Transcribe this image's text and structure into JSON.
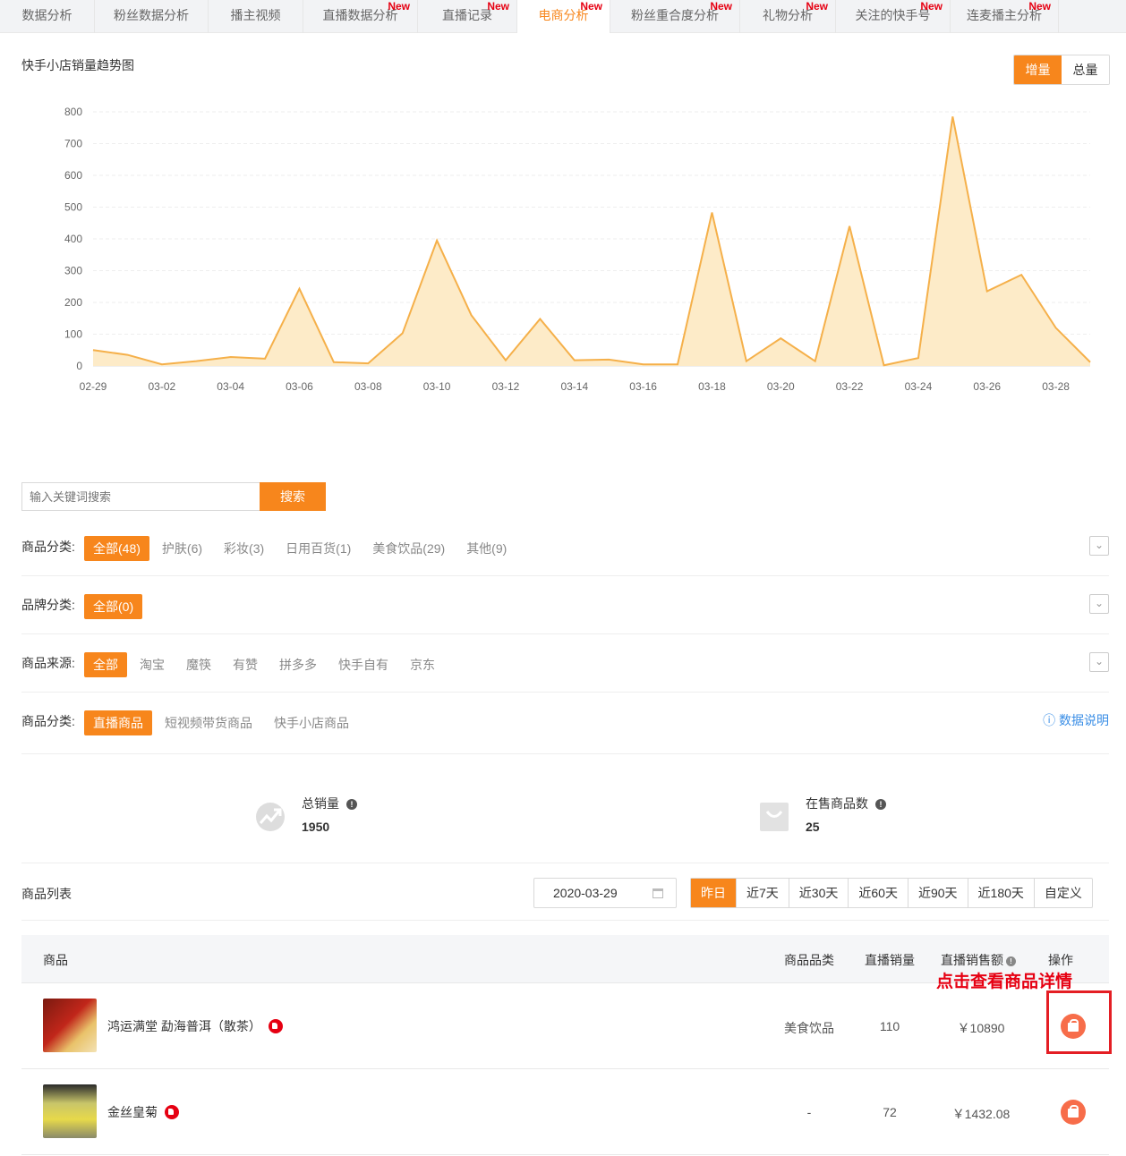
{
  "tabs": [
    {
      "label": "数据分析",
      "new": false,
      "active": false
    },
    {
      "label": "粉丝数据分析",
      "new": false,
      "active": false
    },
    {
      "label": "播主视频",
      "new": false,
      "active": false
    },
    {
      "label": "直播数据分析",
      "new": true,
      "active": false
    },
    {
      "label": "直播记录",
      "new": true,
      "active": false
    },
    {
      "label": "电商分析",
      "new": true,
      "active": true
    },
    {
      "label": "粉丝重合度分析",
      "new": true,
      "active": false
    },
    {
      "label": "礼物分析",
      "new": true,
      "active": false
    },
    {
      "label": "关注的快手号",
      "new": true,
      "active": false
    },
    {
      "label": "连麦播主分析",
      "new": true,
      "active": false
    }
  ],
  "new_badge": "New",
  "chart_title": "快手小店销量趋势图",
  "chart_toggle": [
    {
      "label": "增量",
      "on": true
    },
    {
      "label": "总量",
      "on": false
    }
  ],
  "chart_data": {
    "type": "area",
    "x": [
      "02-29",
      "03-01",
      "03-02",
      "03-03",
      "03-04",
      "03-05",
      "03-06",
      "03-07",
      "03-08",
      "03-09",
      "03-10",
      "03-11",
      "03-12",
      "03-13",
      "03-14",
      "03-15",
      "03-16",
      "03-17",
      "03-18",
      "03-19",
      "03-20",
      "03-21",
      "03-22",
      "03-23",
      "03-24",
      "03-25",
      "03-26",
      "03-27",
      "03-28",
      "03-29"
    ],
    "tick_labels": [
      "02-29",
      "03-02",
      "03-04",
      "03-06",
      "03-08",
      "03-10",
      "03-12",
      "03-14",
      "03-16",
      "03-18",
      "03-20",
      "03-22",
      "03-24",
      "03-26",
      "03-28"
    ],
    "values": [
      50,
      35,
      5,
      15,
      28,
      23,
      243,
      12,
      8,
      103,
      395,
      160,
      18,
      148,
      18,
      20,
      5,
      5,
      483,
      15,
      87,
      15,
      440,
      2,
      25,
      785,
      235,
      287,
      120,
      12
    ],
    "ylim": [
      0,
      800
    ],
    "yticks": [
      0,
      100,
      200,
      300,
      400,
      500,
      600,
      700,
      800
    ],
    "grid": true,
    "line_color": "#f5b04a",
    "fill_color": "#fdebc8"
  },
  "search": {
    "placeholder": "输入关键词搜索",
    "button": "搜索"
  },
  "filters": [
    {
      "label": "商品分类:",
      "options": [
        {
          "t": "全部(48)",
          "on": true
        },
        {
          "t": "护肤(6)",
          "on": false
        },
        {
          "t": "彩妆(3)",
          "on": false
        },
        {
          "t": "日用百货(1)",
          "on": false
        },
        {
          "t": "美食饮品(29)",
          "on": false
        },
        {
          "t": "其他(9)",
          "on": false
        }
      ],
      "expand": true
    },
    {
      "label": "品牌分类:",
      "options": [
        {
          "t": "全部(0)",
          "on": true
        }
      ],
      "expand": true
    },
    {
      "label": "商品来源:",
      "options": [
        {
          "t": "全部",
          "on": true
        },
        {
          "t": "淘宝",
          "on": false
        },
        {
          "t": "魔筷",
          "on": false
        },
        {
          "t": "有赞",
          "on": false
        },
        {
          "t": "拼多多",
          "on": false
        },
        {
          "t": "快手自有",
          "on": false
        },
        {
          "t": "京东",
          "on": false
        }
      ],
      "expand": true
    },
    {
      "label": "商品分类:",
      "options": [
        {
          "t": "直播商品",
          "on": true
        },
        {
          "t": "短视频带货商品",
          "on": false
        },
        {
          "t": "快手小店商品",
          "on": false
        }
      ],
      "expand": false
    }
  ],
  "help_link": "数据说明",
  "stats": {
    "total_sales_label": "总销量",
    "total_sales_value": "1950",
    "on_sale_label": "在售商品数",
    "on_sale_value": "25"
  },
  "product_list": {
    "title": "商品列表",
    "date": "2020-03-29",
    "ranges": [
      {
        "t": "昨日",
        "on": true
      },
      {
        "t": "近7天",
        "on": false
      },
      {
        "t": "近30天",
        "on": false
      },
      {
        "t": "近60天",
        "on": false
      },
      {
        "t": "近90天",
        "on": false
      },
      {
        "t": "近180天",
        "on": false
      },
      {
        "t": "自定义",
        "on": false
      }
    ],
    "columns": {
      "product": "商品",
      "category": "商品品类",
      "sales": "直播销量",
      "revenue": "直播销售额",
      "action": "操作"
    },
    "rows": [
      {
        "name": "鸿运满堂 勐海普洱（散茶）",
        "category": "美食饮品",
        "sales": "110",
        "revenue": "￥10890"
      },
      {
        "name": "金丝皇菊",
        "category": "-",
        "sales": "72",
        "revenue": "￥1432.08"
      }
    ]
  },
  "annotation": "点击查看商品详情"
}
